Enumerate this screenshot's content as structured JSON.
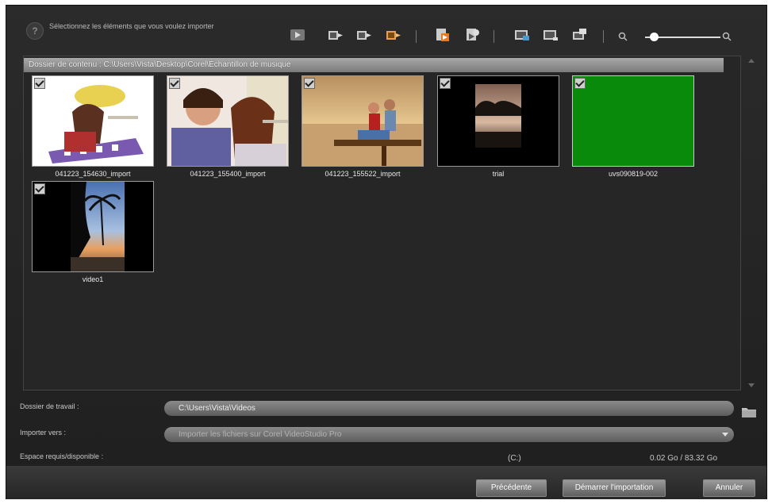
{
  "header": {
    "help_glyph": "?",
    "instruction": "Sélectionnez les éléments que vous voulez importer"
  },
  "toolbar": {
    "icons": [
      "play-icon",
      "import-icon",
      "import-icon",
      "import-icon",
      "insert-icon",
      "insert-icon",
      "select-all-icon",
      "deselect-icon",
      "edit-icon",
      "zoom-out-icon",
      "zoom-in-icon"
    ],
    "zoom_level": 0.12
  },
  "content": {
    "folder_path": "Dossier de contenu : C:\\Users\\Vista\\Desktop\\Corel\\Échantillon de musique",
    "items": [
      {
        "name": "041223_154630_import",
        "checked": true
      },
      {
        "name": "041223_155400_import",
        "checked": true
      },
      {
        "name": "041223_155522_import",
        "checked": true
      },
      {
        "name": "trial",
        "checked": true
      },
      {
        "name": "uvs090819-002",
        "checked": true
      },
      {
        "name": "video1",
        "checked": true
      }
    ]
  },
  "form": {
    "work_folder_label": "Dossier de travail :",
    "work_folder_value": "C:\\Users\\Vista\\Videos",
    "import_to_label": "Importer vers :",
    "import_to_value": "Importer les fichiers sur Corel VideoStudio Pro",
    "space_label": "Espace requis/disponible :",
    "drive": "(C:)",
    "space_value": "0.02 Go / 83.32 Go"
  },
  "buttons": {
    "previous": "Précédente",
    "start_import": "Démarrer l'importation",
    "cancel": "Annuler"
  },
  "colors": {
    "panel_bg": "#262626",
    "green_thumb": "#0a8a0a"
  }
}
